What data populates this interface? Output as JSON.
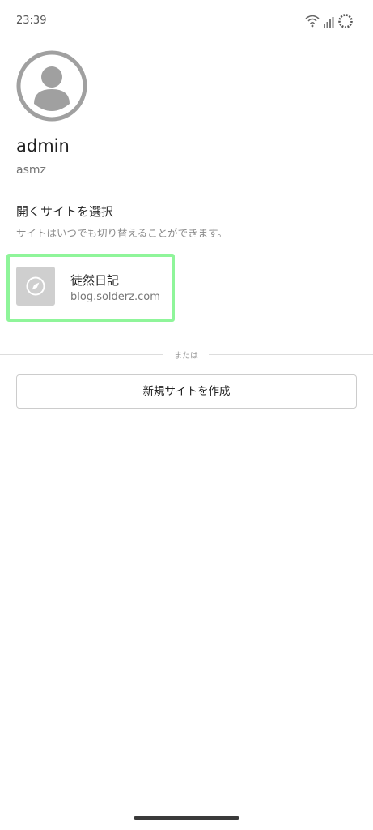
{
  "status_bar": {
    "time": "23:39",
    "icons": [
      "wifi-icon",
      "signal-icon",
      "sync-icon"
    ]
  },
  "profile": {
    "avatar_icon": "person-icon",
    "name": "admin",
    "handle": "asmz"
  },
  "site_picker": {
    "title": "開くサイトを選択",
    "subtitle": "サイトはいつでも切り替えることができます。",
    "sites": [
      {
        "name": "徒然日記",
        "url": "blog.solderz.com",
        "icon": "compass-icon"
      }
    ],
    "highlight_color": "#8ff59a"
  },
  "divider": {
    "label": "または"
  },
  "actions": {
    "create_site_label": "新規サイトを作成"
  }
}
